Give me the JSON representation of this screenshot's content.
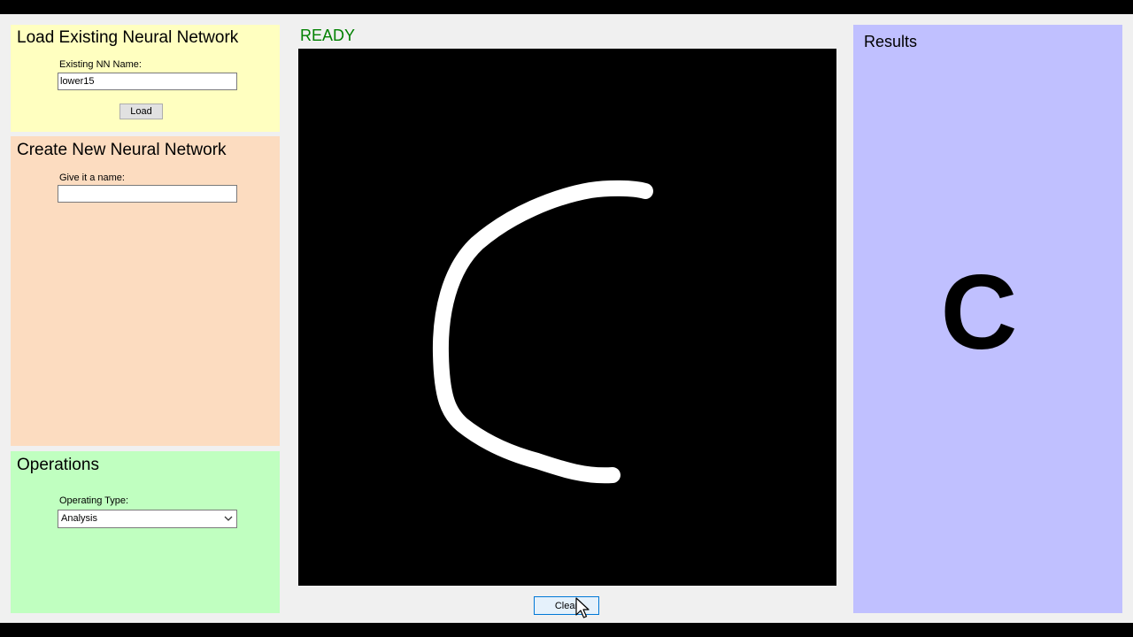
{
  "load_panel": {
    "title": "Load Existing Neural Network",
    "name_label": "Existing NN Name:",
    "name_value": "lower15",
    "load_button": "Load"
  },
  "create_panel": {
    "title": "Create New Neural Network",
    "name_label": "Give it a name:",
    "name_value": ""
  },
  "operations_panel": {
    "title": "Operations",
    "type_label": "Operating Type:",
    "type_value": "Analysis"
  },
  "canvas": {
    "status": "READY",
    "clear_button": "Clear"
  },
  "results": {
    "title": "Results",
    "prediction": "C"
  },
  "colors": {
    "load_panel_bg": "#ffffc0",
    "create_panel_bg": "#fcdcc0",
    "operations_panel_bg": "#c0ffc0",
    "results_panel_bg": "#c0c0ff",
    "status_text": "#008000",
    "canvas_bg": "#000000",
    "stroke": "#ffffff"
  },
  "icons": {
    "dropdown": "chevron-down-icon",
    "cursor": "mouse-cursor-icon"
  }
}
